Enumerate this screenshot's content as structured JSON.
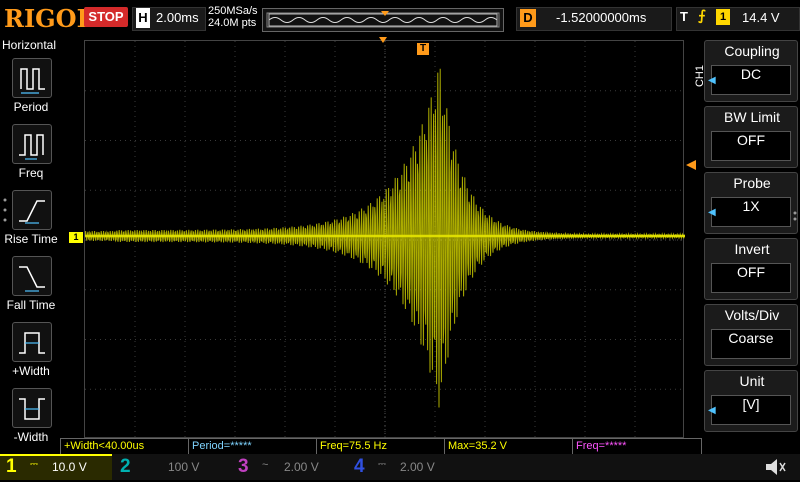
{
  "topbar": {
    "brand": "RIGOL",
    "run_state": "STOP",
    "horizontal_label": "H",
    "timebase": "2.00ms",
    "sample_rate": "250MSa/s",
    "memory_depth": "24.0M pts",
    "delay_label": "D",
    "delay_value": "-1.52000000ms",
    "trigger_label": "T",
    "trigger_edge_icon": "rising-edge-icon",
    "trigger_channel": "1",
    "trigger_level": "14.4 V"
  },
  "left_menu": {
    "title": "Horizontal",
    "items": [
      {
        "label": "Period",
        "icon": "period-icon"
      },
      {
        "label": "Freq",
        "icon": "freq-icon"
      },
      {
        "label": "Rise Time",
        "icon": "rise-time-icon"
      },
      {
        "label": "Fall Time",
        "icon": "fall-time-icon"
      },
      {
        "label": "+Width",
        "icon": "pos-width-icon"
      },
      {
        "label": "-Width",
        "icon": "neg-width-icon"
      }
    ]
  },
  "right_menu": {
    "channel_tag": "CH1",
    "items": [
      {
        "title": "Coupling",
        "value": "DC"
      },
      {
        "title": "BW Limit",
        "value": "OFF"
      },
      {
        "title": "Probe",
        "value": "1X"
      },
      {
        "title": "Invert",
        "value": "OFF"
      },
      {
        "title": "Volts/Div",
        "value": "Coarse"
      },
      {
        "title": "Unit",
        "value": "[V]"
      }
    ]
  },
  "markers": {
    "trigger_position": "T",
    "channel_marker": "1"
  },
  "measurements": [
    {
      "text": "+Width<40.00us",
      "color": "#ffff00"
    },
    {
      "text": "Period=*****",
      "color": "#7fd4ff"
    },
    {
      "text": "Freq=75.5 Hz",
      "color": "#ffff00"
    },
    {
      "text": "Max=35.2 V",
      "color": "#ffff00"
    },
    {
      "text": "Freq=*****",
      "color": "#ff55ff"
    }
  ],
  "channels": [
    {
      "num": "1",
      "scale": "10.0 V",
      "color": "#ffff00",
      "active": true
    },
    {
      "num": "2",
      "scale": "100 V",
      "color": "#00b0b0",
      "active": false
    },
    {
      "num": "3",
      "scale": "2.00 V",
      "color": "#c040c0",
      "active": false
    },
    {
      "num": "4",
      "scale": "2.00 V",
      "color": "#3050e0",
      "active": false
    }
  ],
  "colors": {
    "trace": "#e6e600",
    "accent": "#ff9a1a",
    "stop": "#d42a2a"
  }
}
